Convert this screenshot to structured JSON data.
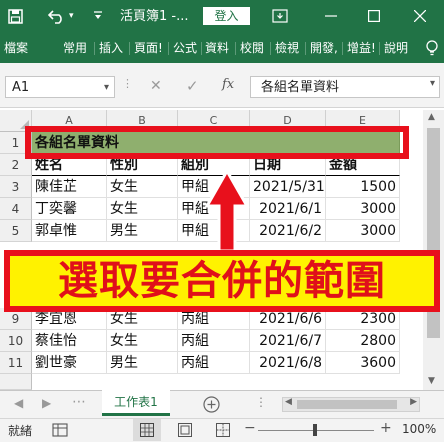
{
  "titlebar": {
    "title": "活頁簿1 -...",
    "login": "登入"
  },
  "ribbon": {
    "tabs": [
      "檔案",
      "常用",
      "插入",
      "頁面!",
      "公式",
      "資料",
      "校閱",
      "檢視",
      "開發,",
      "增益!",
      "說明"
    ]
  },
  "formula_bar": {
    "name_box": "A1",
    "formula": "各組名單資料",
    "cancel": "✕",
    "enter": "✓",
    "fx": "fx"
  },
  "columns": [
    "A",
    "B",
    "C",
    "D",
    "E"
  ],
  "rows": [
    {
      "n": "1",
      "cells": [
        "各組名單資料",
        "",
        "",
        "",
        ""
      ]
    },
    {
      "n": "2",
      "cells": [
        "姓名",
        "性別",
        "組別",
        "日期",
        "金額"
      ]
    },
    {
      "n": "3",
      "cells": [
        "陳佳芷",
        "女生",
        "甲組",
        "2021/5/31",
        "1500"
      ]
    },
    {
      "n": "4",
      "cells": [
        "丁奕馨",
        "女生",
        "甲組",
        "2021/6/1",
        "3000"
      ]
    },
    {
      "n": "5",
      "cells": [
        "郭卓惟",
        "男生",
        "甲組",
        "2021/6/2",
        "3000"
      ]
    },
    {
      "n": "9",
      "cells": [
        "李宜恩",
        "女生",
        "丙組",
        "2021/6/6",
        "2300"
      ]
    },
    {
      "n": "10",
      "cells": [
        "蔡佳怡",
        "女生",
        "丙組",
        "2021/6/7",
        "2800"
      ]
    },
    {
      "n": "11",
      "cells": [
        "劉世豪",
        "男生",
        "丙組",
        "2021/6/8",
        "3600"
      ]
    }
  ],
  "sheet_tab": "工作表1",
  "status": {
    "ready": "就緒",
    "zoom": "100%"
  },
  "annotation": {
    "callout": "選取要合併的範圍"
  },
  "colors": {
    "excel_green": "#217346",
    "highlight": "#8faf6e",
    "annotation_red": "#e8101c",
    "callout_yellow": "#fff200"
  }
}
